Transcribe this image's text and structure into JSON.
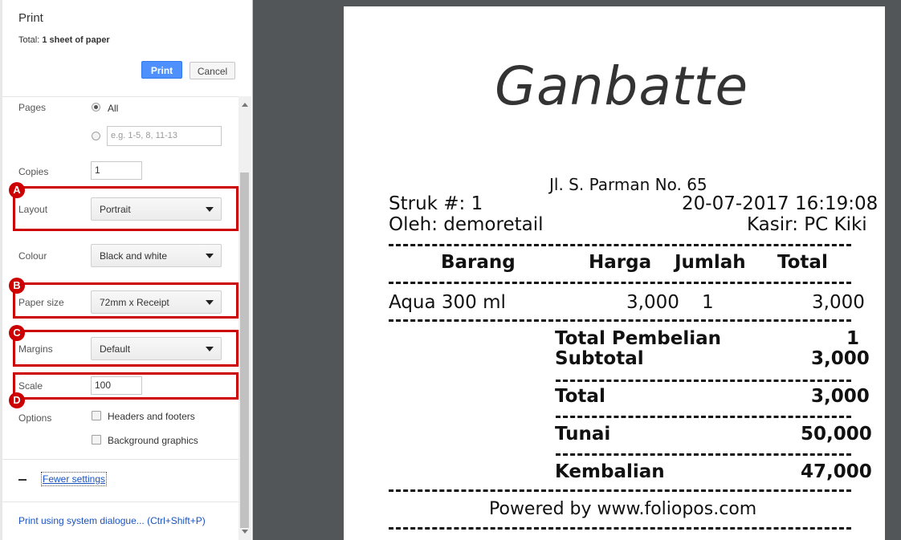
{
  "dialog": {
    "title": "Print",
    "total_prefix": "Total: ",
    "total_value": "1 sheet of paper",
    "print_button": "Print",
    "cancel_button": "Cancel"
  },
  "settings": {
    "pages_label": "Pages",
    "pages_all_option": "All",
    "pages_custom_placeholder": "e.g. 1-5, 8, 11-13",
    "copies_label": "Copies",
    "copies_value": "1",
    "layout_label": "Layout",
    "layout_value": "Portrait",
    "colour_label": "Colour",
    "colour_value": "Black and white",
    "paper_size_label": "Paper size",
    "paper_size_value": "72mm x Receipt",
    "margins_label": "Margins",
    "margins_value": "Default",
    "scale_label": "Scale",
    "scale_value": "100",
    "options_label": "Options",
    "headers_footers_label": "Headers and footers",
    "background_graphics_label": "Background graphics",
    "fewer_settings_link": "Fewer settings",
    "system_dialog_link": "Print using system dialogue... (Ctrl+Shift+P)"
  },
  "annotations": {
    "badge_a": "A",
    "badge_b": "B",
    "badge_c": "C",
    "badge_d": "D",
    "highlight_color": "#cc0000"
  },
  "receipt": {
    "logo_text": "Ganbatte",
    "address": "Jl. S. Parman No. 65",
    "struk": "Struk #: 1",
    "datetime": "20-07-2017 16:19:08",
    "oleh": "Oleh: demoretail",
    "kasir": "Kasir: PC Kiki",
    "headers": {
      "item": "Barang",
      "price": "Harga",
      "qty": "Jumlah",
      "total": "Total"
    },
    "items": [
      {
        "name": "Aqua 300 ml",
        "price": "3,000",
        "qty": "1",
        "total": "3,000"
      }
    ],
    "total_pembelian_label": "Total Pembelian",
    "total_pembelian_value": "1",
    "subtotal_label": "Subtotal",
    "subtotal_value": "3,000",
    "total_label": "Total",
    "total_value": "3,000",
    "tunai_label": "Tunai",
    "tunai_value": "50,000",
    "kembalian_label": "Kembalian",
    "kembalian_value": "47,000",
    "footer": "Powered by www.foliopos.com"
  },
  "colors": {
    "primary_button": "#4d90fe",
    "preview_background": "#525659"
  }
}
